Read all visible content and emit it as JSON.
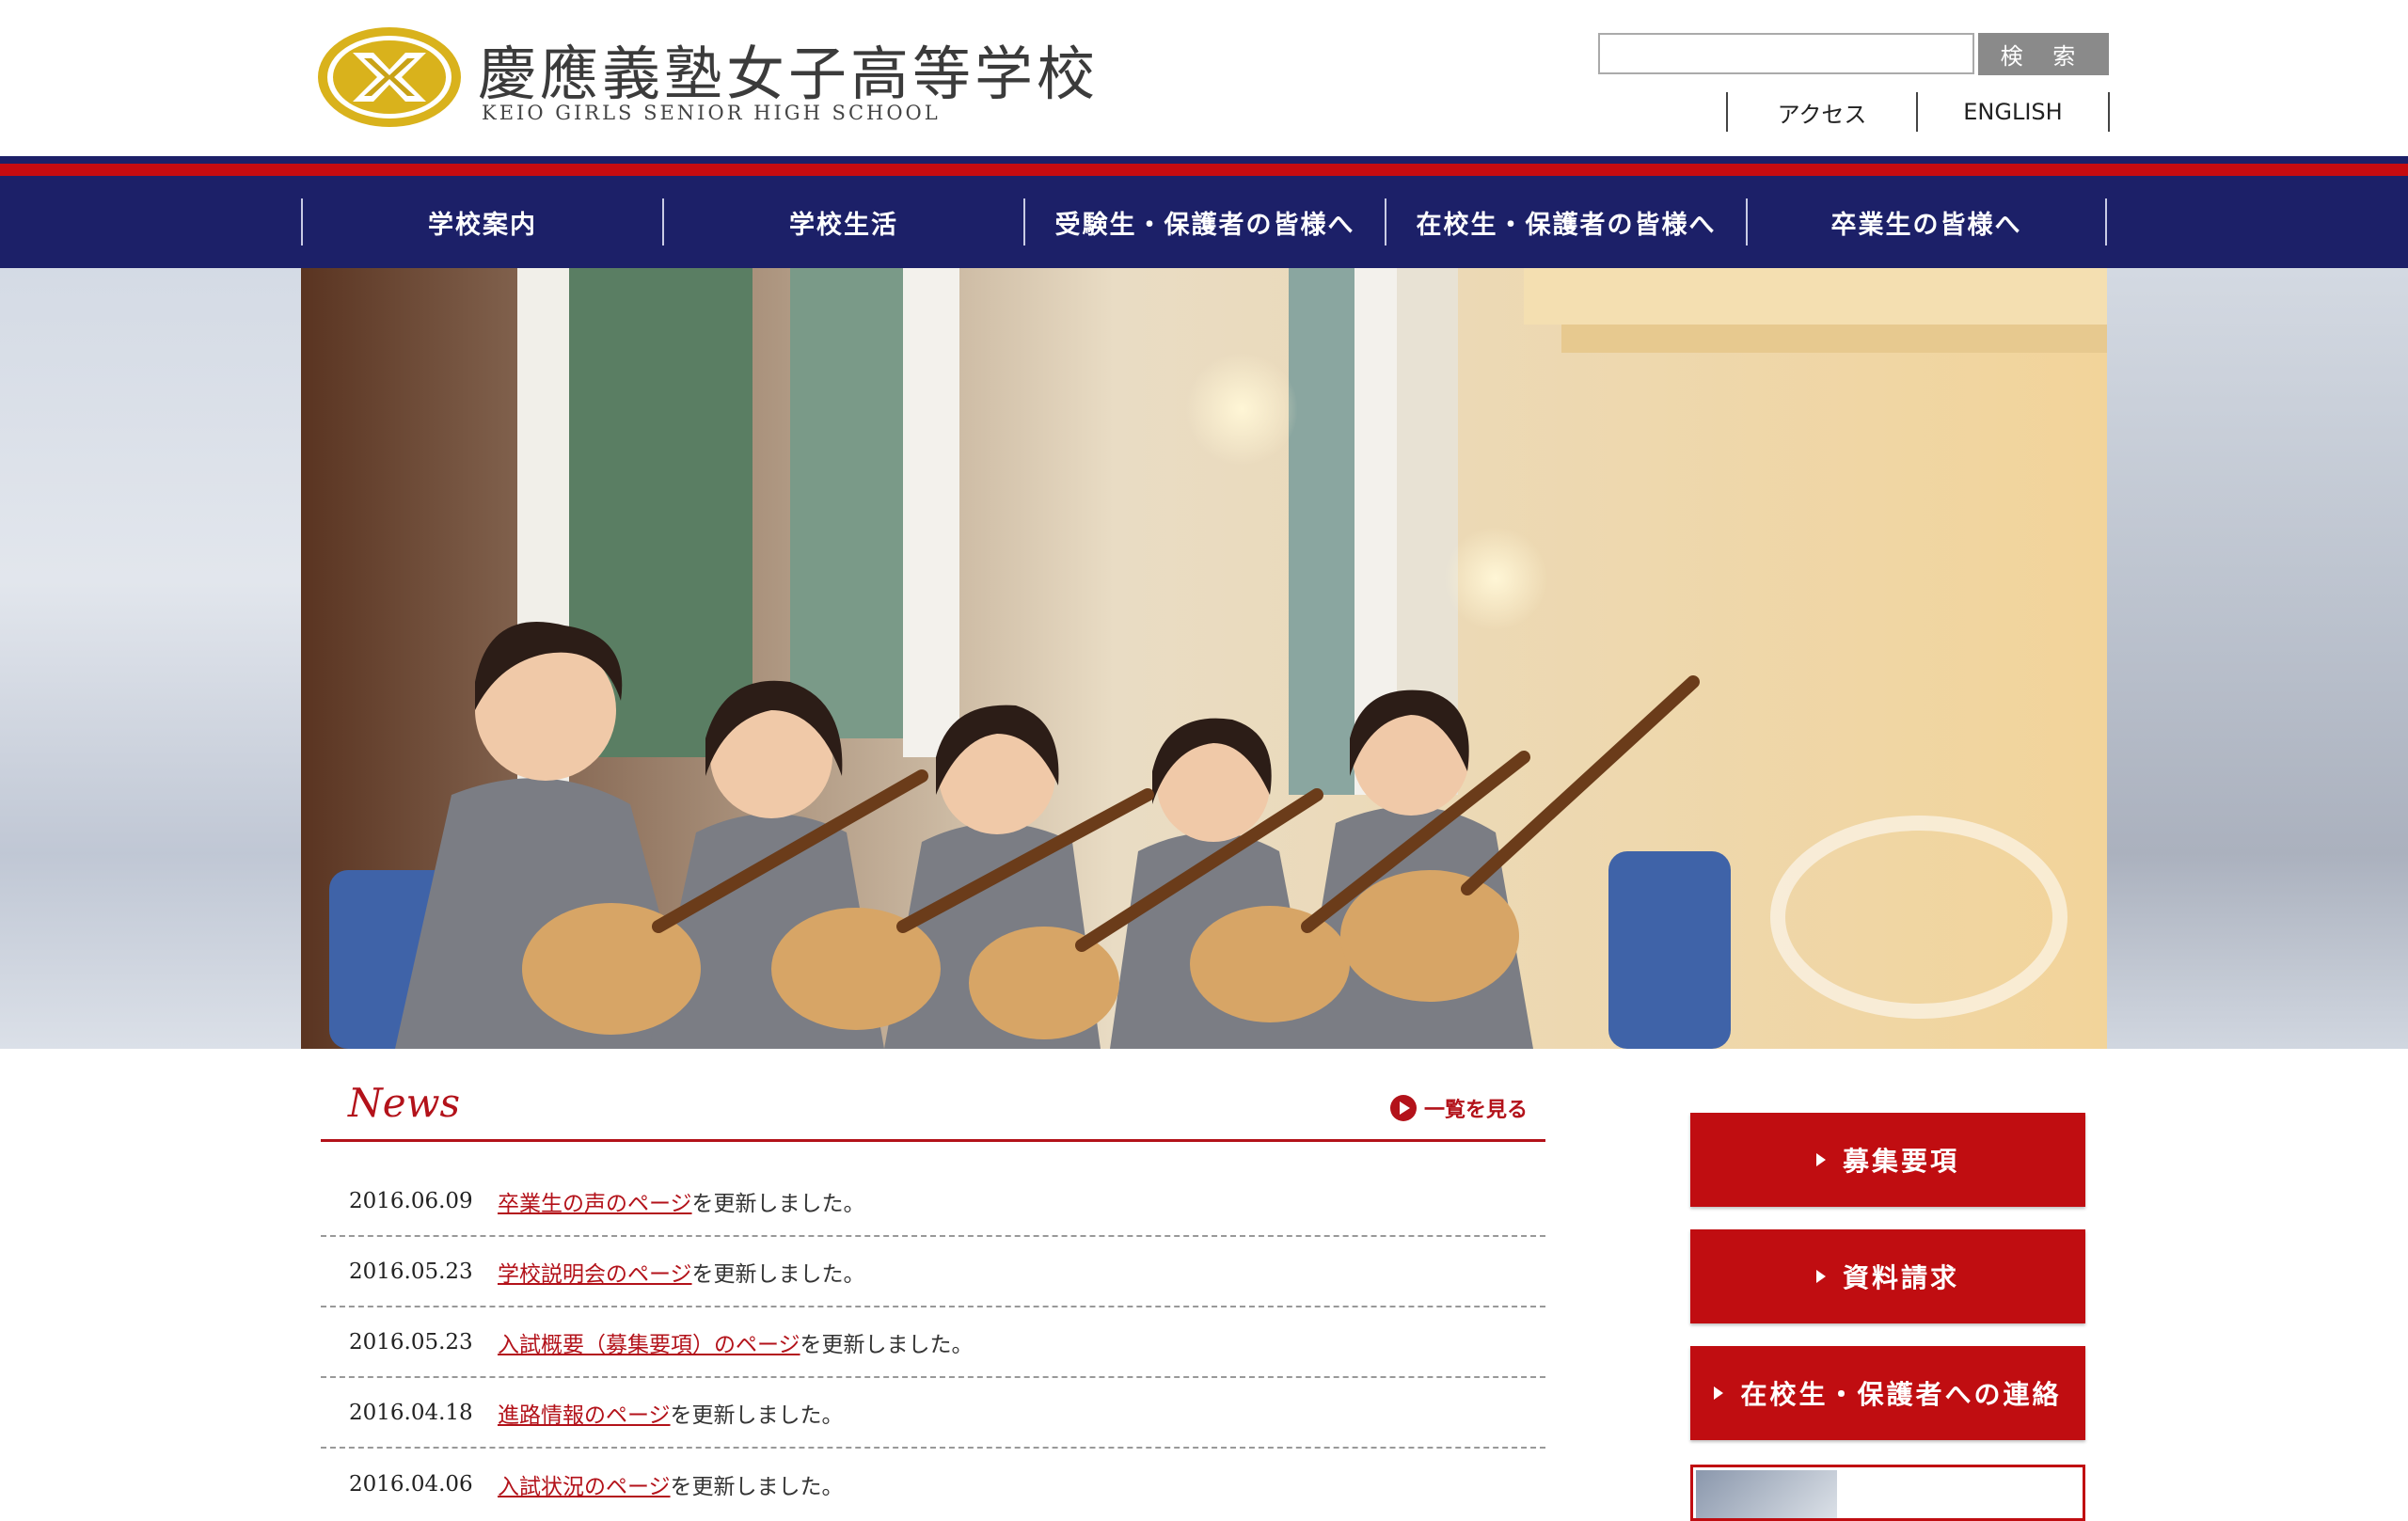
{
  "header": {
    "school_name_jp": "慶應義塾女子高等学校",
    "school_name_en": "KEIO GIRLS SENIOR HIGH SCHOOL",
    "search": {
      "placeholder": "",
      "button_label": "検 索"
    },
    "util_links": [
      "アクセス",
      "ENGLISH"
    ]
  },
  "nav": {
    "items": [
      "学校案内",
      "学校生活",
      "受験生・保護者の皆様へ",
      "在校生・保護者の皆様へ",
      "卒業生の皆様へ"
    ]
  },
  "news": {
    "title": "News",
    "more_label": "一覧を見る",
    "items": [
      {
        "date": "2016.06.09",
        "link": "卒業生の声のページ",
        "suffix": "を更新しました。"
      },
      {
        "date": "2016.05.23",
        "link": "学校説明会のページ",
        "suffix": "を更新しました。"
      },
      {
        "date": "2016.05.23",
        "link": "入試概要（募集要項）のページ",
        "suffix": "を更新しました。"
      },
      {
        "date": "2016.04.18",
        "link": "進路情報のページ",
        "suffix": "を更新しました。"
      },
      {
        "date": "2016.04.06",
        "link": "入試状況のページ",
        "suffix": "を更新しました。"
      }
    ]
  },
  "sidebar": {
    "buttons": [
      "募集要項",
      "資料請求",
      "在校生・保護者への連絡"
    ]
  },
  "colors": {
    "navy": "#1c2068",
    "red": "#c60b10",
    "gold": "#d9b21c"
  }
}
